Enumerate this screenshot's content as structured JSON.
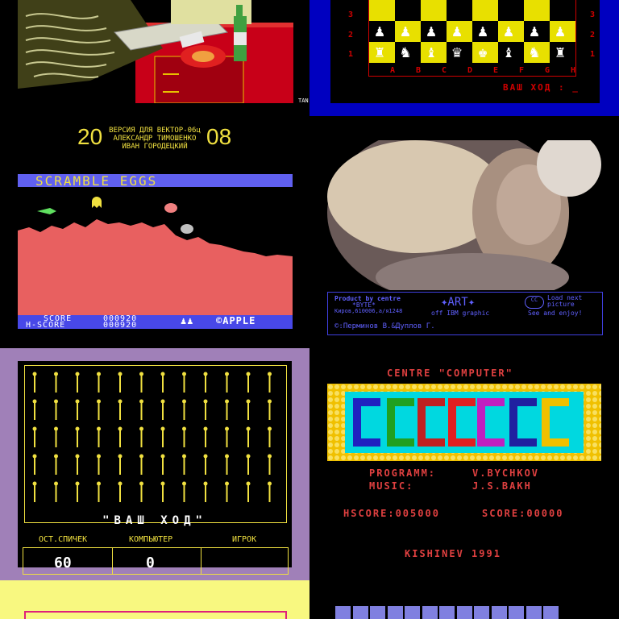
{
  "p1": {
    "credit": "TAN"
  },
  "p2": {
    "ranks": [
      "3",
      "2",
      "1"
    ],
    "files": [
      "A",
      "B",
      "C",
      "D",
      "E",
      "F",
      "G",
      "H"
    ],
    "prompt": "ВАШ ХОД : _",
    "colors": {
      "frame": "#0000c0",
      "board": "#d00000",
      "light": "#e8e000"
    }
  },
  "p3": {
    "year_left": "20",
    "year_right": "08",
    "credits": [
      "ВЕРСИЯ ДЛЯ ВЕКТОР-06ц",
      "АЛЕКСАНДР ТИМОШЕНКО",
      "ИВАН ГОРОДЕЦКИЙ"
    ],
    "title": "SCRAMBLE EGGS",
    "score_label": "SCORE",
    "score": "000920",
    "hscore_label": "H-SCORE",
    "hscore": "000920",
    "brand": "©APPLE",
    "lives": "♟♟"
  },
  "p4": {
    "product": "Product by centre",
    "byte": "*BYTE*",
    "addr": "Киров,610006,а/я1248",
    "art": "✦ART✦",
    "art_sub": "off IBM graphic",
    "load1": "Load next",
    "load2": "picture",
    "load3": "See and enjoy!",
    "authors": "©:Перминов В.&Дуплов Г."
  },
  "p5": {
    "prompt": "\"ВАШ ХОД\"",
    "headers": [
      "ОСТ.СПИЧЕК",
      "КОМПЬЮТЕР",
      "ИГРОК"
    ],
    "values": [
      "60",
      "0",
      ""
    ]
  },
  "p6": {
    "centre": "CENTRE   \"COMPUTER\"",
    "programm_label": "PROGRAMM:",
    "programm": "V.BYCHKOV",
    "music_label": "MUSIC:",
    "music": "J.S.BAKH",
    "hscore": "HSCORE:005000",
    "score": "SCORE:00000",
    "city": "KISHINEV   1991",
    "logo": "COLUMNS"
  }
}
